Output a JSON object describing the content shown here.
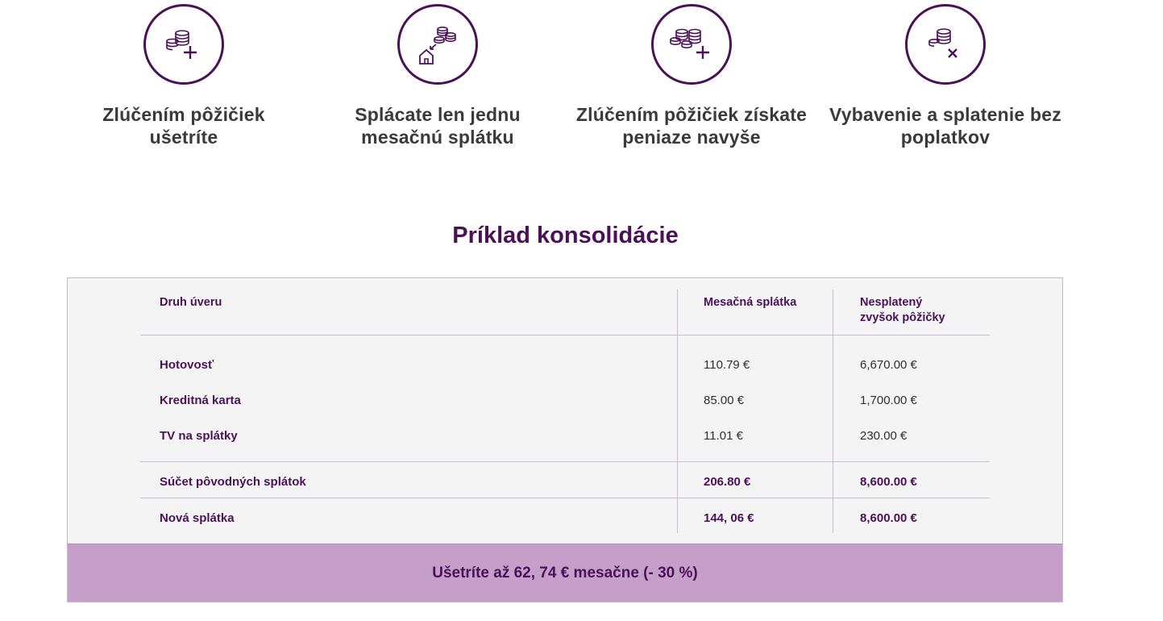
{
  "features": [
    {
      "icon": "coins-plus-icon",
      "title_line1": "Zlúčením pôžičiek",
      "title_line2": "ušetríte"
    },
    {
      "icon": "house-coins-icon",
      "title_line1": "Splácate len jednu",
      "title_line2": "mesačnú splátku"
    },
    {
      "icon": "coins-stack-plus-icon",
      "title_line1": "Zlúčením pôžičiek získate",
      "title_line2": "peniaze navyše"
    },
    {
      "icon": "coins-cross-icon",
      "title_line1": "Vybavenie a splatenie bez",
      "title_line2": "poplatkov"
    }
  ],
  "section_title": "Príklad konsolidácie",
  "table": {
    "headers": {
      "type": "Druh úveru",
      "monthly": "Mesačná splátka",
      "remaining_line1": "Nesplatený",
      "remaining_line2": "zvyšok pôžičky"
    },
    "rows": [
      {
        "type": "Hotovosť",
        "monthly": "110.79 €",
        "remaining": "6,670.00 €"
      },
      {
        "type": "Kreditná karta",
        "monthly": "85.00 €",
        "remaining": "1,700.00 €"
      },
      {
        "type": "TV na splátky",
        "monthly": "11.01 €",
        "remaining": "230.00 €"
      }
    ],
    "sum_row": {
      "type": "Súčet pôvodných splátok",
      "monthly": "206.80 €",
      "remaining": "8,600.00 €"
    },
    "new_row": {
      "type": "Nová splátka",
      "monthly": "144, 06 €",
      "remaining": "8,600.00 €"
    }
  },
  "savings_text": "Ušetríte až 62, 74 € mesačne (- 30 %)",
  "colors": {
    "brand": "#4a1158",
    "savings_bg": "#c59fca",
    "table_bg": "#f4f4f5"
  }
}
